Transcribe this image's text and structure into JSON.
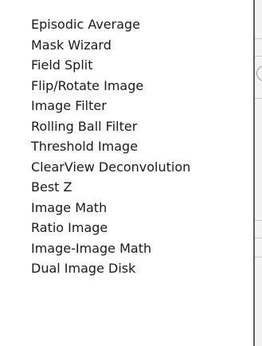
{
  "menu": {
    "items": [
      {
        "id": "episodic-average",
        "label": "Episodic Average"
      },
      {
        "id": "mask-wizard",
        "label": "Mask Wizard"
      },
      {
        "id": "field-split",
        "label": "Field Split"
      },
      {
        "id": "flip-rotate-image",
        "label": "Flip/Rotate Image"
      },
      {
        "id": "image-filter",
        "label": "Image Filter"
      },
      {
        "id": "rolling-ball-filter",
        "label": "Rolling Ball Filter"
      },
      {
        "id": "threshold-image",
        "label": "Threshold Image"
      },
      {
        "id": "clearview-deconvolution",
        "label": "ClearView Deconvolution"
      },
      {
        "id": "best-z",
        "label": "Best Z"
      },
      {
        "id": "image-math",
        "label": "Image Math"
      },
      {
        "id": "ratio-image",
        "label": "Ratio Image"
      },
      {
        "id": "image-image-math",
        "label": "Image-Image Math"
      },
      {
        "id": "dual-image-disk",
        "label": "Dual Image Disk"
      }
    ]
  },
  "colors": {
    "menu_background": "#ffffff",
    "menu_text": "#1a1a1a",
    "menu_border": "#5d5d5d"
  }
}
